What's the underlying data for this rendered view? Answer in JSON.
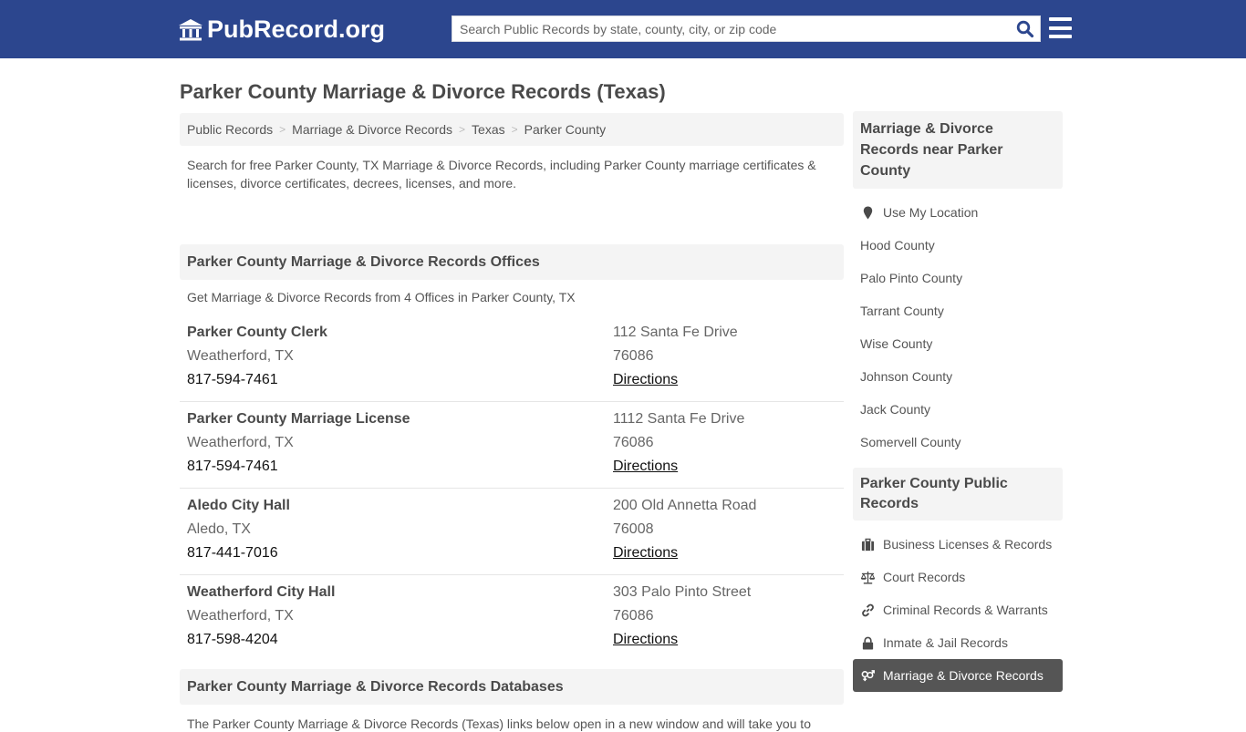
{
  "header": {
    "logo_text": "PubRecord.org",
    "search_placeholder": "Search Public Records by state, county, city, or zip code",
    "colors": {
      "brand": "#2c468e",
      "search_icon": "#2c468e"
    }
  },
  "page": {
    "title": "Parker County Marriage & Divorce Records (Texas)"
  },
  "breadcrumb": [
    {
      "label": "Public Records"
    },
    {
      "label": "Marriage & Divorce Records"
    },
    {
      "label": "Texas"
    },
    {
      "label": "Parker County"
    }
  ],
  "intro": "Search for free Parker County, TX Marriage & Divorce Records, including Parker County marriage certificates & licenses, divorce certificates, decrees, licenses, and more.",
  "offices_section": {
    "title": "Parker County Marriage & Divorce Records Offices",
    "subtitle": "Get Marriage & Divorce Records from 4 Offices in Parker County, TX",
    "offices": [
      {
        "name": "Parker County Clerk",
        "city": "Weatherford, TX",
        "phone": "817-594-7461",
        "address": "112 Santa Fe Drive",
        "zip": "76086",
        "directions_label": "Directions"
      },
      {
        "name": "Parker County Marriage License",
        "city": "Weatherford, TX",
        "phone": "817-594-7461",
        "address": "1112 Santa Fe Drive",
        "zip": "76086",
        "directions_label": "Directions"
      },
      {
        "name": "Aledo City Hall",
        "city": "Aledo, TX",
        "phone": "817-441-7016",
        "address": "200 Old Annetta Road",
        "zip": "76008",
        "directions_label": "Directions"
      },
      {
        "name": "Weatherford City Hall",
        "city": "Weatherford, TX",
        "phone": "817-598-4204",
        "address": "303 Palo Pinto Street",
        "zip": "76086",
        "directions_label": "Directions"
      }
    ]
  },
  "databases_section": {
    "title": "Parker County Marriage & Divorce Records Databases",
    "text": "The Parker County Marriage & Divorce Records (Texas) links below open in a new window and will take you to"
  },
  "sidebar": {
    "nearby_title": "Marriage & Divorce Records near Parker County",
    "use_location_label": "Use My Location",
    "nearby_counties": [
      "Hood County",
      "Palo Pinto County",
      "Tarrant County",
      "Wise County",
      "Johnson County",
      "Jack County",
      "Somervell County"
    ],
    "public_records_title": "Parker County Public Records",
    "public_records_links": [
      {
        "label": "Business Licenses & Records",
        "icon": "briefcase-icon"
      },
      {
        "label": "Court Records",
        "icon": "balance-scale-icon"
      },
      {
        "label": "Criminal Records & Warrants",
        "icon": "link-icon"
      },
      {
        "label": "Inmate & Jail Records",
        "icon": "lock-icon"
      },
      {
        "label": "Marriage & Divorce Records",
        "icon": "venus-mars-icon",
        "active": true
      }
    ]
  }
}
